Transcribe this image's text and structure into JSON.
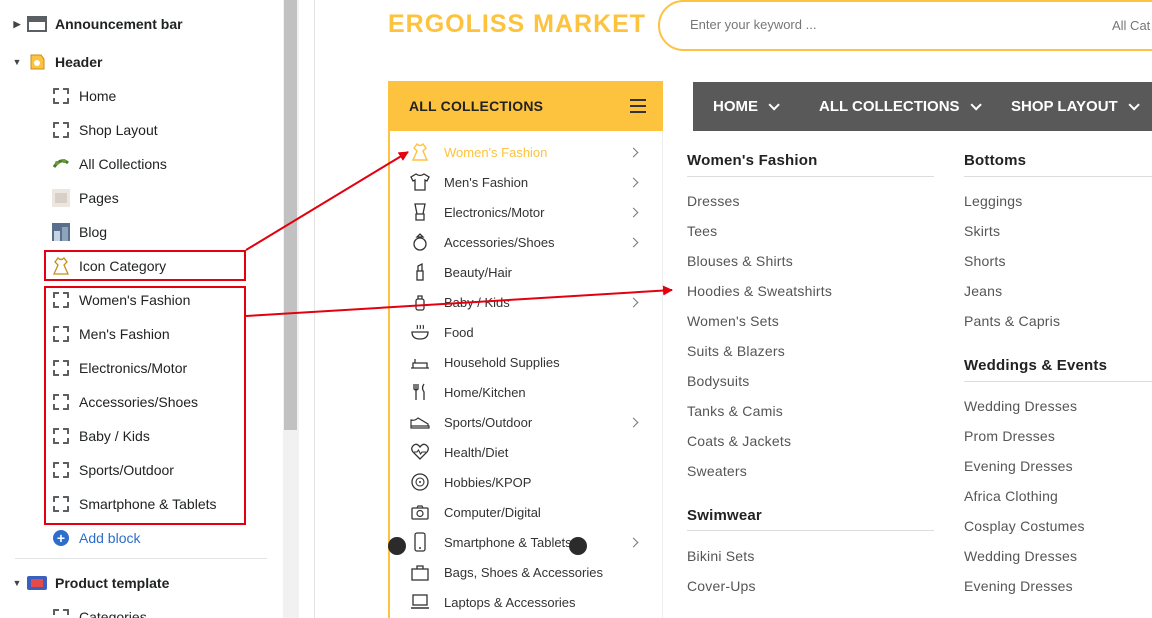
{
  "sidebar": {
    "announcement_bar": "Announcement bar",
    "header": "Header",
    "header_items": [
      "Home",
      "Shop Layout",
      "All Collections",
      "Pages",
      "Blog",
      "Icon Category",
      "Women's Fashion",
      "Men's Fashion",
      "Electronics/Motor",
      "Accessories/Shoes",
      "Baby / Kids",
      "Sports/Outdoor",
      "Smartphone & Tablets"
    ],
    "add_block": "Add block",
    "product_template": "Product template",
    "categories": "Categories"
  },
  "store": {
    "logo": "ERGOLISS MARKET",
    "search_placeholder": "Enter your keyword ...",
    "search_category": "All Cat",
    "collections_title": "ALL COLLECTIONS",
    "nav": [
      "HOME",
      "ALL COLLECTIONS",
      "SHOP LAYOUT"
    ],
    "categories": [
      {
        "label": "Women's Fashion",
        "icon": "dress-icon",
        "arrow": true,
        "active": true
      },
      {
        "label": "Men's Fashion",
        "icon": "shirt-icon",
        "arrow": true
      },
      {
        "label": "Electronics/Motor",
        "icon": "blender-icon",
        "arrow": true
      },
      {
        "label": "Accessories/Shoes",
        "icon": "ring-icon",
        "arrow": true
      },
      {
        "label": "Beauty/Hair",
        "icon": "lipstick-icon",
        "arrow": false
      },
      {
        "label": "Baby / Kids",
        "icon": "baby-bottle-icon",
        "arrow": true
      },
      {
        "label": "Food",
        "icon": "food-bowl-icon",
        "arrow": false
      },
      {
        "label": "Household Supplies",
        "icon": "household-icon",
        "arrow": false
      },
      {
        "label": "Home/Kitchen",
        "icon": "kitchen-utensils-icon",
        "arrow": false
      },
      {
        "label": "Sports/Outdoor",
        "icon": "sneaker-icon",
        "arrow": true
      },
      {
        "label": "Health/Diet",
        "icon": "heart-pulse-icon",
        "arrow": false
      },
      {
        "label": "Hobbies/KPOP",
        "icon": "vinyl-record-icon",
        "arrow": false
      },
      {
        "label": "Computer/Digital",
        "icon": "camera-icon",
        "arrow": false
      },
      {
        "label": "Smartphone & Tablets",
        "icon": "smartphone-icon",
        "arrow": true
      },
      {
        "label": "Bags, Shoes & Accessories",
        "icon": "bag-icon",
        "arrow": false
      },
      {
        "label": "Laptops & Accessories",
        "icon": "laptop-icon",
        "arrow": false
      }
    ],
    "mega_menu": {
      "womens_fashion": {
        "title": "Women's Fashion",
        "links": [
          "Dresses",
          "Tees",
          "Blouses & Shirts",
          "Hoodies & Sweatshirts",
          "Women's Sets",
          "Suits & Blazers",
          "Bodysuits",
          "Tanks & Camis",
          "Coats & Jackets",
          "Sweaters"
        ]
      },
      "swimwear": {
        "title": "Swimwear",
        "links": [
          "Bikini Sets",
          "Cover-Ups"
        ]
      },
      "bottoms": {
        "title": "Bottoms",
        "links": [
          "Leggings",
          "Skirts",
          "Shorts",
          "Jeans",
          "Pants & Capris"
        ]
      },
      "weddings": {
        "title": "Weddings & Events",
        "links": [
          "Wedding Dresses",
          "Prom Dresses",
          "Evening Dresses",
          "Africa Clothing",
          "Cosplay Costumes",
          "Wedding Dresses",
          "Evening Dresses"
        ]
      }
    }
  },
  "colors": {
    "accent_yellow": "#fdc23e",
    "nav_gray": "#595959",
    "annotation_red": "#e3000f",
    "link_blue": "#2c6ecb"
  }
}
